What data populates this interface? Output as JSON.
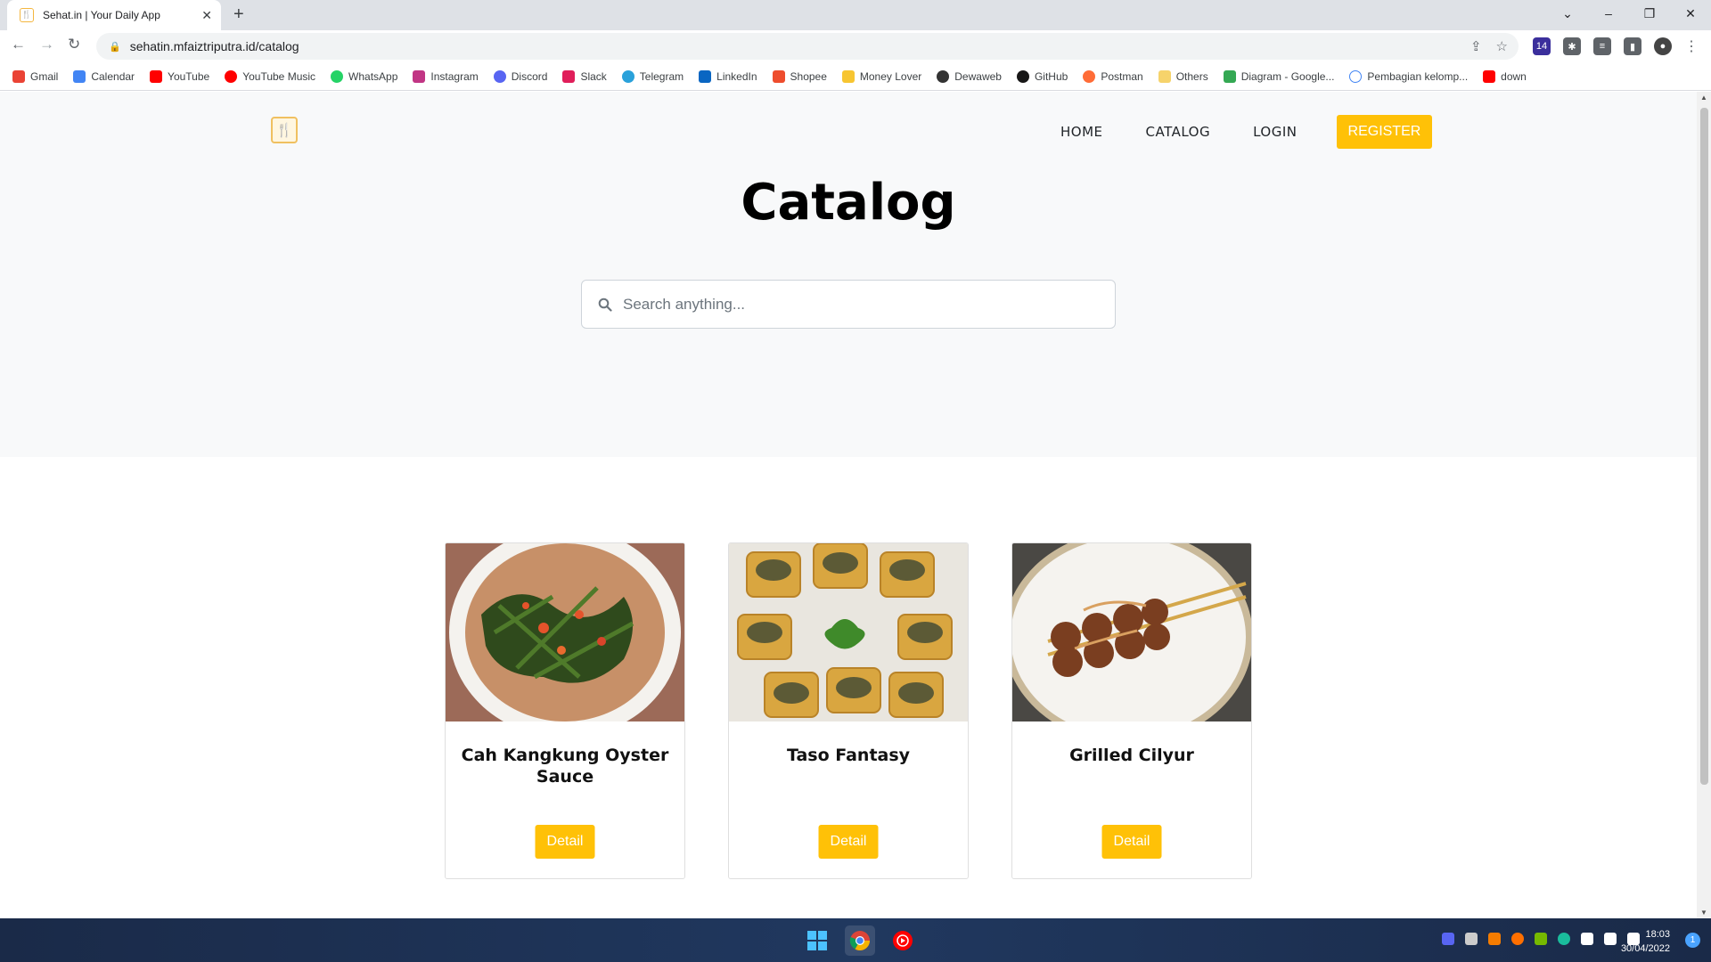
{
  "browser": {
    "tab_title": "Sehat.in | Your Daily App",
    "url": "sehatin.mfaiztriputra.id/catalog",
    "bookmarks": [
      "Gmail",
      "Calendar",
      "YouTube",
      "YouTube Music",
      "WhatsApp",
      "Instagram",
      "Discord",
      "Slack",
      "Telegram",
      "LinkedIn",
      "Shopee",
      "Money Lover",
      "Dewaweb",
      "GitHub",
      "Postman",
      "Others",
      "Diagram - Google...",
      "Pembagian kelomp...",
      "down"
    ],
    "extension_badge": "14"
  },
  "nav": {
    "home": "HOME",
    "catalog": "CATALOG",
    "login": "LOGIN",
    "register": "REGISTER"
  },
  "hero": {
    "title": "Catalog",
    "search_placeholder": "Search anything..."
  },
  "cards": [
    {
      "title": "Cah Kangkung Oyster Sauce",
      "button": "Detail"
    },
    {
      "title": "Taso Fantasy",
      "button": "Detail"
    },
    {
      "title": "Grilled Cilyur",
      "button": "Detail"
    }
  ],
  "taskbar": {
    "time": "18:03",
    "date": "30/04/2022",
    "notifications": "1"
  }
}
